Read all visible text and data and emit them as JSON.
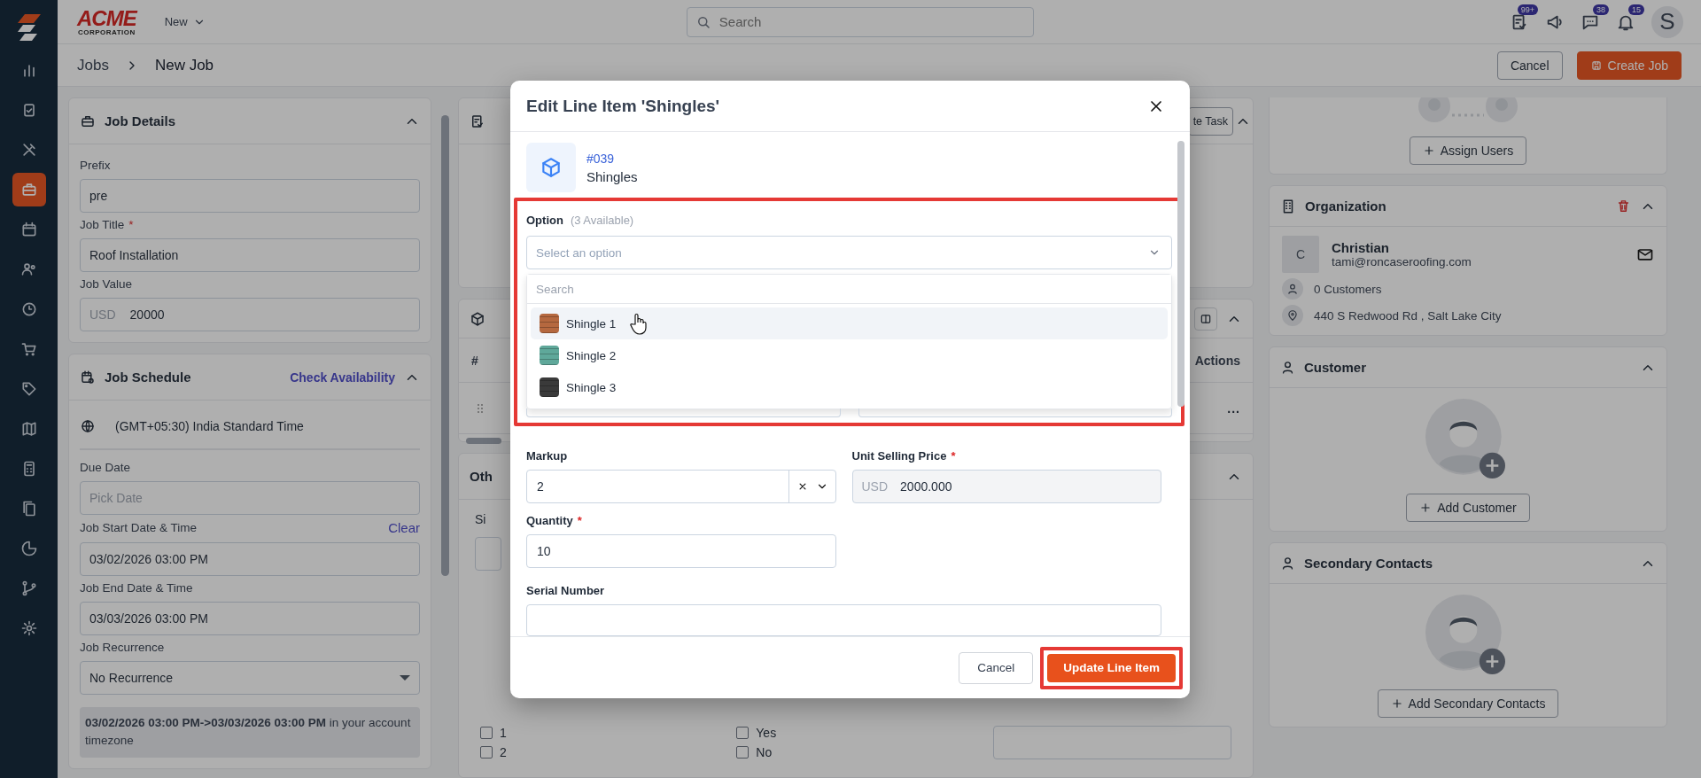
{
  "sidebar": {
    "items": [
      {
        "selected": false
      },
      {
        "selected": false
      },
      {
        "selected": false
      },
      {
        "selected": true
      },
      {
        "selected": false
      },
      {
        "selected": false
      },
      {
        "selected": false
      },
      {
        "selected": false
      },
      {
        "selected": false
      },
      {
        "selected": false
      },
      {
        "selected": false
      },
      {
        "selected": false
      },
      {
        "selected": false
      },
      {
        "selected": false
      },
      {
        "selected": false
      }
    ]
  },
  "header": {
    "logo": "ACME",
    "logo_sub": "CORPORATION",
    "new_menu": "New",
    "search": {
      "placeholder": "Search"
    },
    "badges": [
      "99+",
      "38",
      "15"
    ],
    "avatar": "S"
  },
  "breadcrumb": [
    "Jobs",
    "New Job"
  ],
  "page_actions": {
    "cancel": "Cancel",
    "create": "Create Job"
  },
  "job_details": {
    "title": "Job Details",
    "fields": [
      {
        "label": "Prefix",
        "value": "pre"
      },
      {
        "label": "Job Title",
        "required_mark": "*",
        "value": "Roof Installation"
      },
      {
        "label": "Job Value",
        "prefix": "USD",
        "value": "20000"
      }
    ]
  },
  "job_schedule": {
    "title": "Job Schedule",
    "link": "Check Availability",
    "timezone": "(GMT+05:30) India Standard Time",
    "fields": [
      {
        "label": "Due Date",
        "kind": "input",
        "placeholder": "Pick Date"
      },
      {
        "label": "Job Start Date & Time",
        "kind": "input",
        "action": "Clear",
        "value": "03/02/2026 03:00 PM"
      },
      {
        "label": "Job End Date & Time",
        "kind": "input",
        "value": "03/03/2026 03:00 PM"
      },
      {
        "label": "Job Recurrence",
        "kind": "select",
        "value": "No Recurrence"
      }
    ],
    "summary": "**03/02/2026 03:00 PM->03/03/2026 03:00 PM** in your account timezone"
  },
  "tasks_card": {
    "button": "te Task"
  },
  "line_items_card": {
    "columns": [
      "#",
      "Actions"
    ],
    "row_menu": "..."
  },
  "other_card": {
    "title": "Oth",
    "field_label": "Si",
    "checkboxes_left": [
      {
        "label": "1",
        "checked": false
      },
      {
        "label": "2",
        "checked": false
      }
    ],
    "checkboxes_right": [
      {
        "label": "Yes",
        "checked": false
      },
      {
        "label": "No",
        "checked": false
      }
    ]
  },
  "assign_users": {
    "button": "Assign Users"
  },
  "organization": {
    "title": "Organization",
    "initial": "C",
    "name": "Christian",
    "email": "tami@roncaseroofing.com",
    "customers": "0 Customers",
    "address": "440 S Redwood Rd , Salt Lake City"
  },
  "customer": {
    "title": "Customer",
    "button": "Add Customer"
  },
  "secondary_contacts": {
    "title": "Secondary Contacts",
    "button": "Add Secondary Contacts"
  },
  "modal": {
    "title": "Edit Line Item 'Shingles'",
    "item": {
      "code": "#039",
      "name": "Shingles"
    },
    "option": {
      "label": "Option",
      "hint": "(3 Available)",
      "placeholder": "Select an option",
      "search_placeholder": "Search",
      "options": [
        {
          "label": "Shingle 1",
          "color": "#b5683f",
          "highlighted": true
        },
        {
          "label": "Shingle 2",
          "color": "#5fa89a",
          "highlighted": false
        },
        {
          "label": "Shingle 3",
          "color": "#3a3a3a",
          "highlighted": false
        }
      ]
    },
    "markup": {
      "label": "Markup",
      "value": "2"
    },
    "unit_price": {
      "label": "Unit Selling Price",
      "required_mark": "*",
      "prefix": "USD",
      "value": "2000.000"
    },
    "quantity": {
      "label": "Quantity",
      "required_mark": "*",
      "value": "10"
    },
    "serial": {
      "label": "Serial Number"
    },
    "cancel": "Cancel",
    "submit": "Update Line Item"
  }
}
